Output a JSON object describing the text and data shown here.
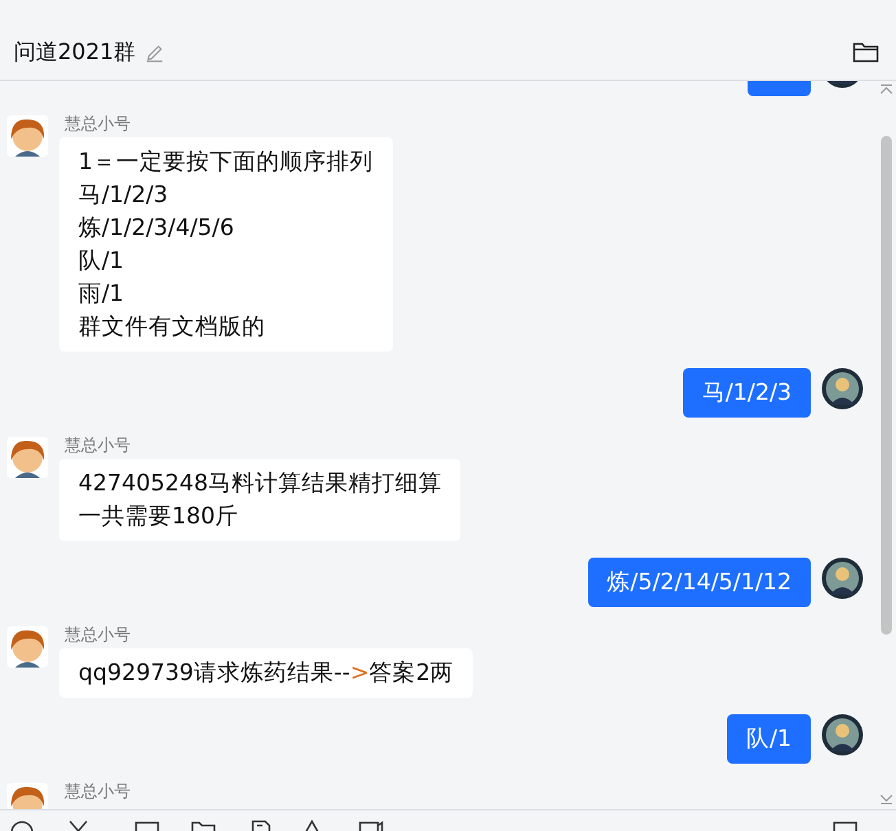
{
  "header": {
    "title": "问道2021群"
  },
  "messages": [
    {
      "kind": "outgoing"
    },
    {
      "kind": "incoming",
      "sender": "慧总小号",
      "lines": [
        [
          {
            "text": "1＝一定要按下面的顺序排列",
            "highlighted": false
          }
        ],
        [
          {
            "text": "马/1/2/3",
            "highlighted": false
          }
        ],
        [
          {
            "text": "炼/1/2/3/4/5/6",
            "highlighted": false
          }
        ],
        [
          {
            "text": "队/1",
            "highlighted": false
          }
        ],
        [
          {
            "text": "雨/1",
            "highlighted": false
          }
        ],
        [
          {
            "text": "群文件有文档版的",
            "highlighted": false
          }
        ]
      ]
    },
    {
      "kind": "outgoing",
      "lines": [
        [
          {
            "text": "马/1/2/3",
            "highlighted": false
          }
        ]
      ]
    },
    {
      "kind": "incoming",
      "sender": "慧总小号",
      "lines": [
        [
          {
            "text": "427405248马料计算结果精打细算",
            "highlighted": false
          }
        ],
        [
          {
            "text": "一共需要180斤",
            "highlighted": false
          }
        ]
      ]
    },
    {
      "kind": "outgoing",
      "lines": [
        [
          {
            "text": "炼/5/2/14/5/1/12",
            "highlighted": false
          }
        ]
      ]
    },
    {
      "kind": "incoming",
      "sender": "慧总小号",
      "lines": [
        [
          {
            "text": "qq929739请求炼药结果--",
            "highlighted": false
          },
          {
            "text": ">",
            "highlighted": true
          },
          {
            "text": "答案2两",
            "highlighted": false
          }
        ]
      ]
    },
    {
      "kind": "outgoing",
      "lines": [
        [
          {
            "text": "队/1",
            "highlighted": false
          }
        ]
      ]
    },
    {
      "kind": "incoming",
      "sender": "慧总小号"
    }
  ]
}
